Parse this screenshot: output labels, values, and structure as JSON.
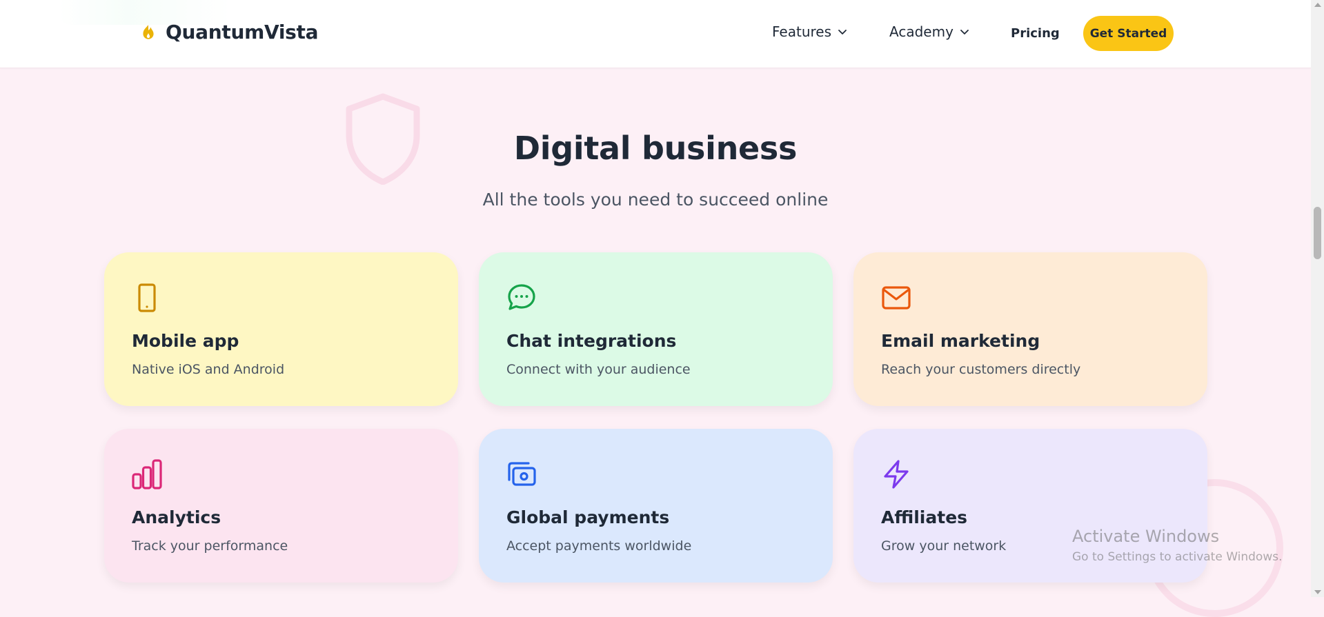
{
  "brand": {
    "name": "QuantumVista",
    "icon": "flame-icon",
    "icon_color": "#eab308"
  },
  "nav": {
    "features_label": "Features",
    "academy_label": "Academy",
    "pricing_label": "Pricing",
    "cta_label": "Get Started",
    "cta_color": "#fac515"
  },
  "section": {
    "title": "Digital business",
    "subtitle": "All the tools you need to succeed online"
  },
  "cards": [
    {
      "title": "Mobile app",
      "description": "Native iOS and Android",
      "icon": "smartphone-icon",
      "bg": "#fef7c3",
      "icon_color": "#ca8a04"
    },
    {
      "title": "Chat integrations",
      "description": "Connect with your audience",
      "icon": "chat-bubble-icon",
      "bg": "#dcfae6",
      "icon_color": "#16a34a"
    },
    {
      "title": "Email marketing",
      "description": "Reach your customers directly",
      "icon": "mail-icon",
      "bg": "#feebd6",
      "icon_color": "#ea580c"
    },
    {
      "title": "Analytics",
      "description": "Track your performance",
      "icon": "bar-chart-icon",
      "bg": "#fce4f0",
      "icon_color": "#db2777"
    },
    {
      "title": "Global payments",
      "description": "Accept payments worldwide",
      "icon": "money-icon",
      "bg": "#dbe8fd",
      "icon_color": "#2563eb"
    },
    {
      "title": "Affiliates",
      "description": "Grow your network",
      "icon": "lightning-icon",
      "bg": "#ece7fc",
      "icon_color": "#7c3aed"
    }
  ],
  "watermark": {
    "title": "Activate Windows",
    "subtitle": "Go to Settings to activate Windows."
  }
}
